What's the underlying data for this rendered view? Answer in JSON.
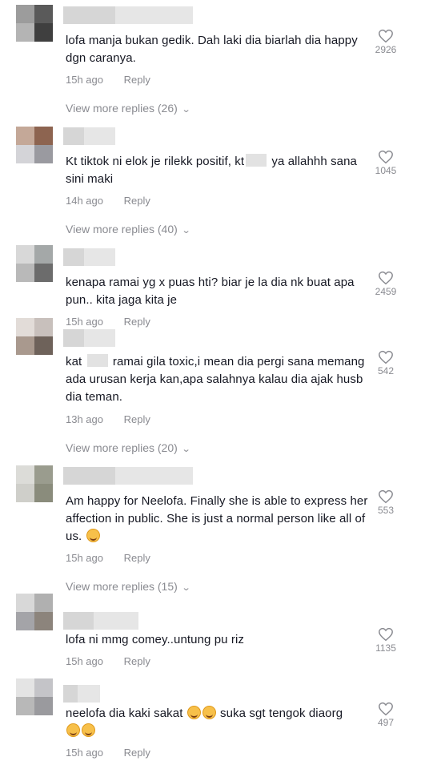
{
  "comments": [
    {
      "text": "lofa manja bukan gedik. Dah laki dia biarlah dia happy dgn caranya.",
      "time": "15h ago",
      "reply": "Reply",
      "likes": "2926",
      "more": "View more replies (26)"
    },
    {
      "text_a": "Kt tiktok ni elok je rilekk positif, kt",
      "text_b": " ya allahhh sana sini maki",
      "time": "14h ago",
      "reply": "Reply",
      "likes": "1045",
      "more": "View more replies (40)"
    },
    {
      "text": "kenapa ramai yg x puas hti? biar je la dia nk buat apa pun.. kita jaga kita je",
      "time": "15h ago",
      "reply": "Reply",
      "likes": "2459"
    },
    {
      "text_a": "kat ",
      "text_b": " ramai gila toxic,i mean dia pergi sana memang ada urusan kerja kan,apa salahnya kalau dia ajak husb dia teman.",
      "time": "13h ago",
      "reply": "Reply",
      "likes": "542",
      "more": "View more replies (20)"
    },
    {
      "text": "Am happy for Neelofa. Finally she is able to express her affection in public. She is just a normal person like all of us.",
      "time": "15h ago",
      "reply": "Reply",
      "likes": "553",
      "more": "View more replies (15)"
    },
    {
      "text": "lofa ni mmg comey..untung pu riz",
      "time": "15h ago",
      "reply": "Reply",
      "likes": "1135"
    },
    {
      "text_a": "neelofa dia kaki sakat",
      "text_b": " suka sgt tengok diaorg",
      "time": "15h ago",
      "reply": "Reply",
      "likes": "497"
    }
  ],
  "icons": {
    "like": "heart-outline-icon",
    "expand": "chevron-down-icon",
    "emoji": "smiling-face-emoji"
  },
  "colors": {
    "text": "#161823",
    "muted": "#8a8b91",
    "background": "#ffffff"
  }
}
